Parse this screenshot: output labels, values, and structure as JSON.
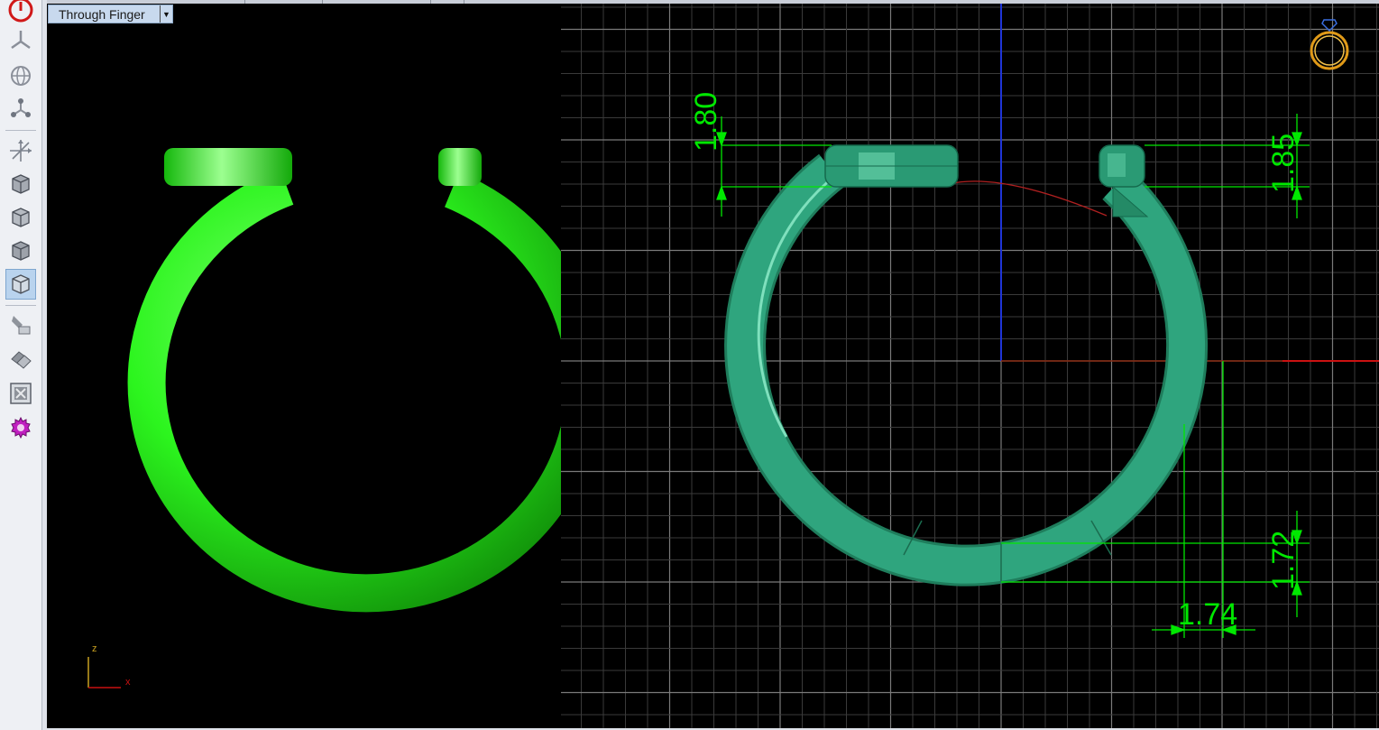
{
  "view_selector": {
    "value": "Through Finger",
    "dropdown_icon": "chevron-down-icon"
  },
  "toolbar": {
    "buttons": [
      {
        "name": "power-icon",
        "active": false
      },
      {
        "name": "top-view-icon",
        "active": false
      },
      {
        "name": "globe-icon",
        "active": false
      },
      {
        "name": "nodes-icon",
        "active": false
      },
      {
        "name": "axes-icon",
        "active": false
      },
      {
        "name": "cube-view-1-icon",
        "active": false
      },
      {
        "name": "cube-view-2-icon",
        "active": false
      },
      {
        "name": "cube-view-3-icon",
        "active": false
      },
      {
        "name": "cube-view-4-icon",
        "active": true
      },
      {
        "name": "render-paint-icon",
        "active": false
      },
      {
        "name": "render-layers-icon",
        "active": false
      },
      {
        "name": "zoom-extents-icon",
        "active": false
      },
      {
        "name": "settings-gear-icon",
        "active": false
      }
    ]
  },
  "left_viewport": {
    "axis_labels": {
      "z": "z",
      "x": "x"
    },
    "model_color": "#2cf51e"
  },
  "right_viewport": {
    "model_color": "#2fa57e",
    "dimension_color": "#00e800",
    "dimensions": {
      "top_left_height": "1.80",
      "top_right_height": "1.85",
      "bottom_thickness": "1.72",
      "side_width": "1.74"
    },
    "ring_size_icon": "ring-size-icon"
  },
  "colors": {
    "viewport_bg": "#000000",
    "grid_minor": "#3a3a3a",
    "grid_major": "#7a7a7a",
    "axis_x": "#cc1111",
    "axis_y": "#1f35d8",
    "selected_tool": "#b9d3ee"
  }
}
